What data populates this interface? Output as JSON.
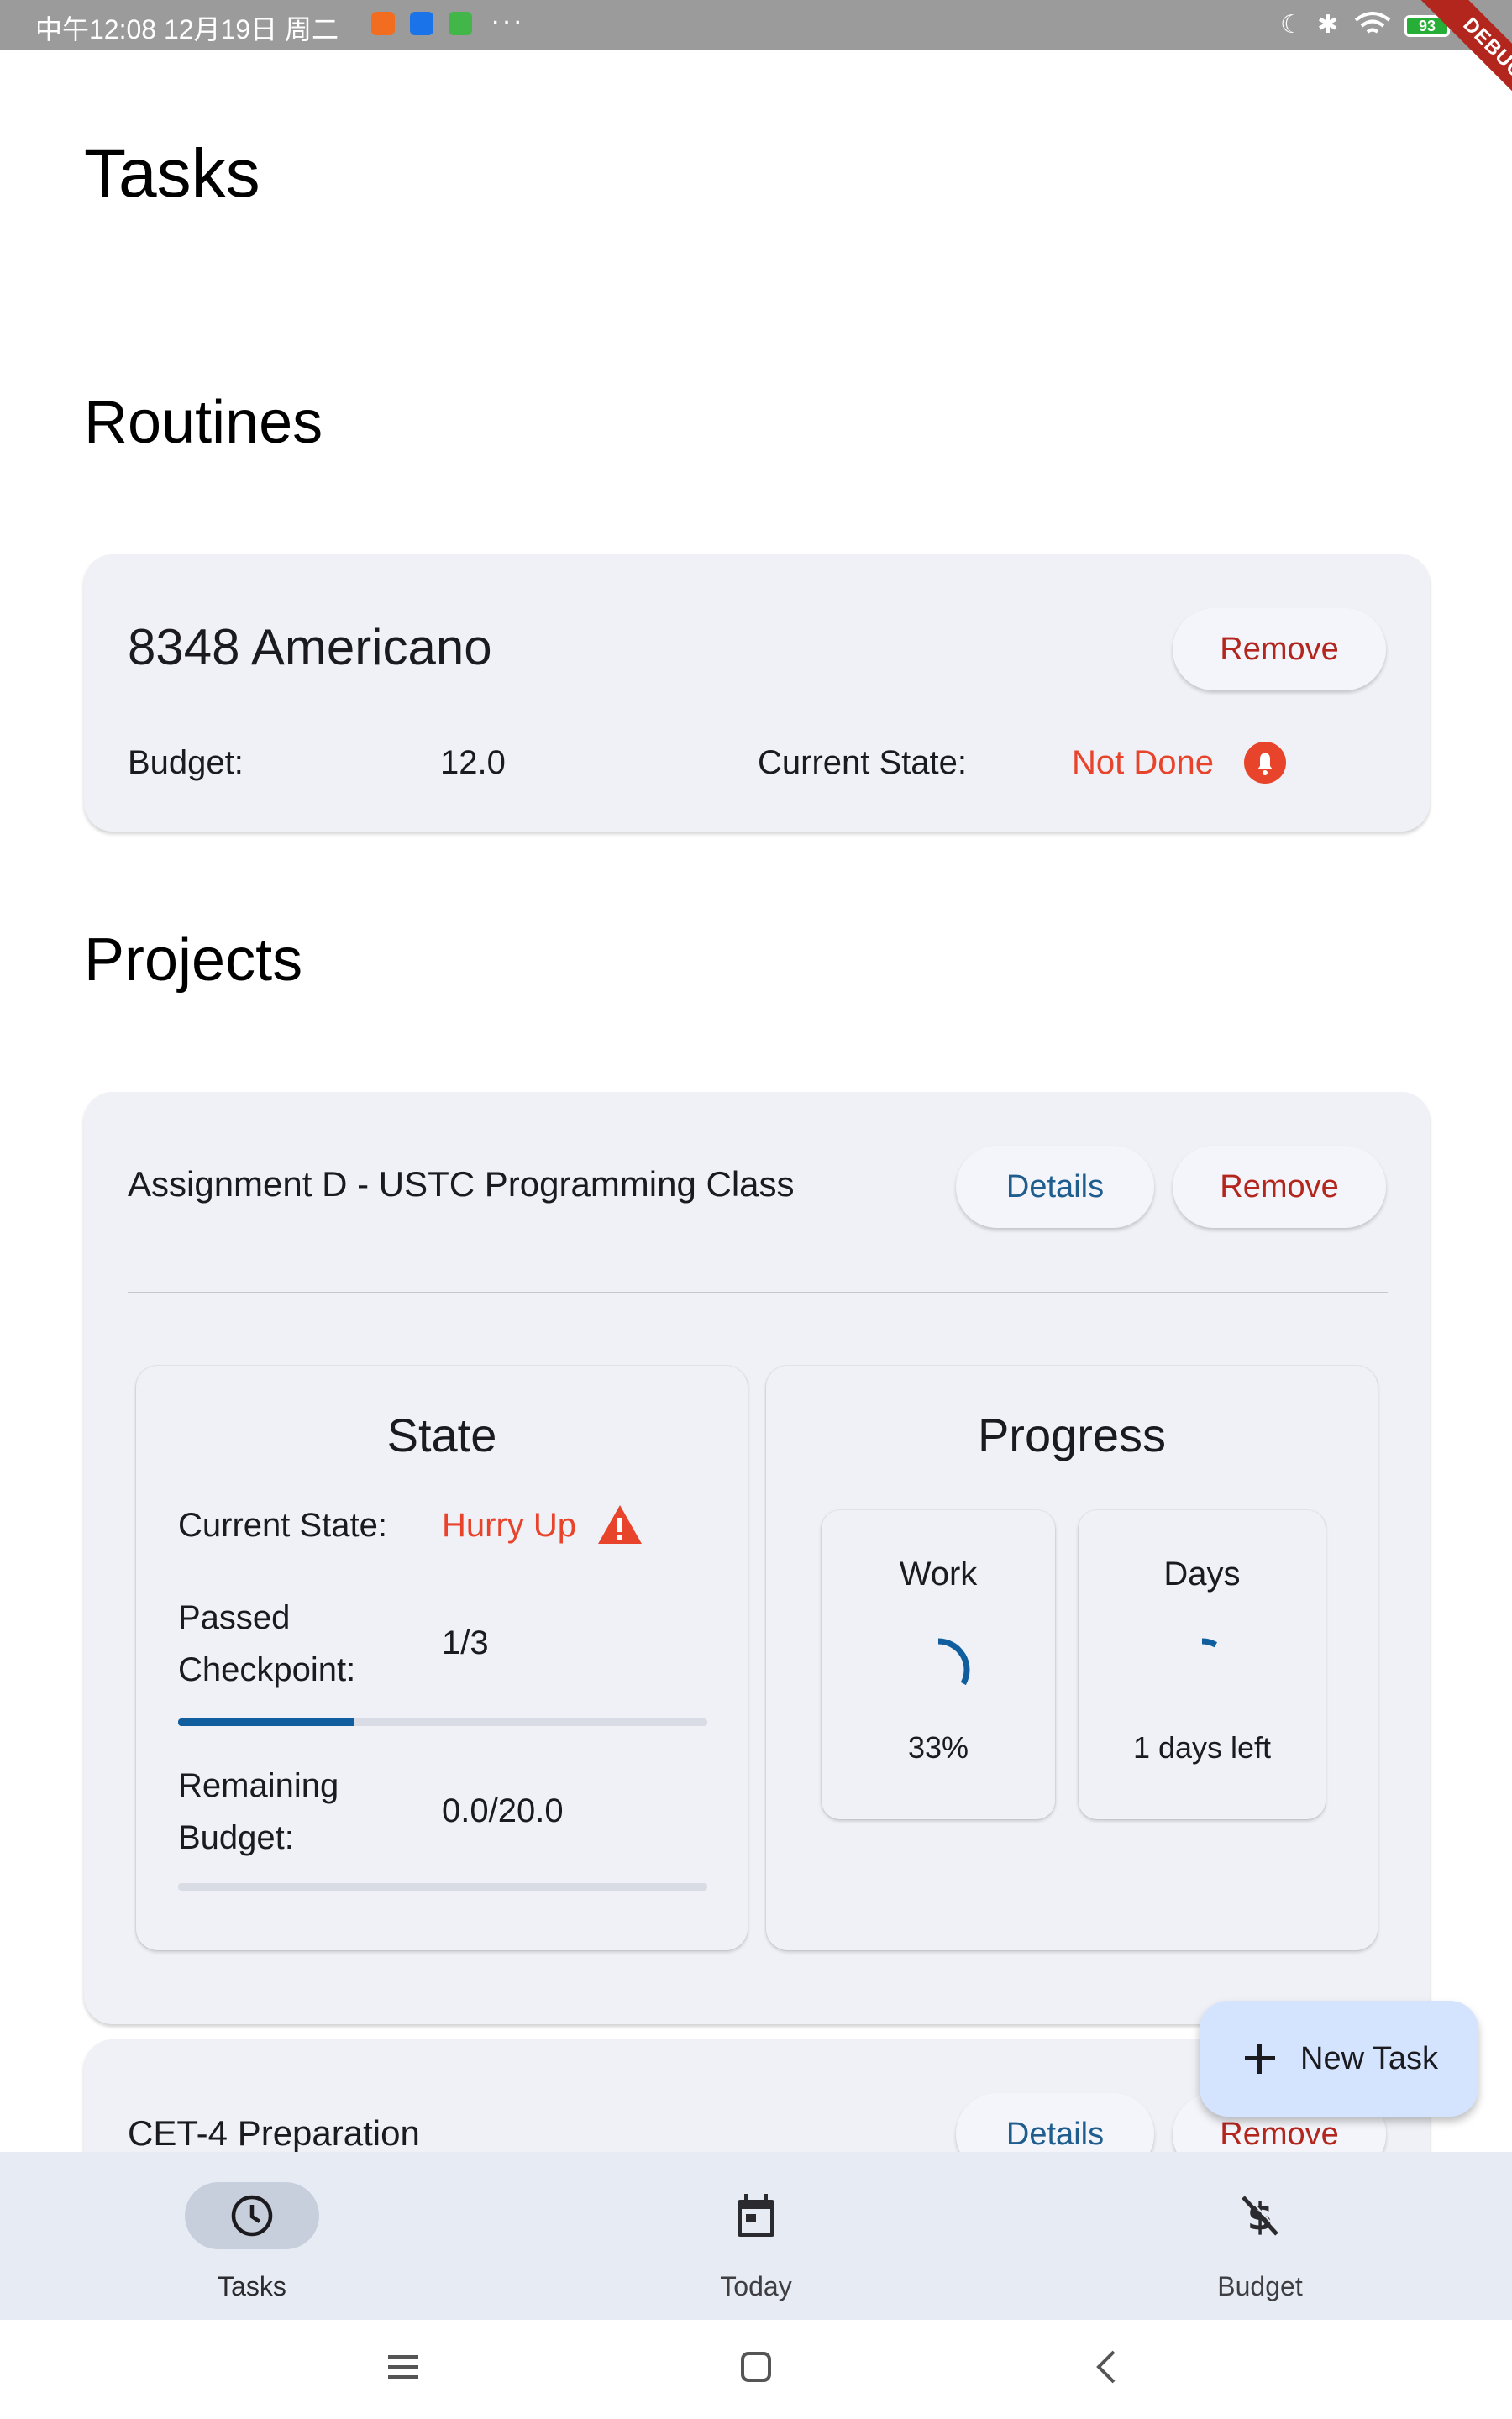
{
  "status_bar": {
    "time": "中午12:08 12月19日 周二",
    "battery": "93",
    "debug_banner": "DEBUG"
  },
  "page_title": "Tasks",
  "routines": {
    "heading": "Routines",
    "item": {
      "name": "8348 Americano",
      "remove_label": "Remove",
      "budget_label": "Budget:",
      "budget_value": "12.0",
      "state_label": "Current State:",
      "state_value": "Not Done"
    }
  },
  "projects": {
    "heading": "Projects",
    "items": [
      {
        "name": "Assignment D - USTC Programming Class",
        "details_label": "Details",
        "remove_label": "Remove",
        "state_panel": {
          "title": "State",
          "current_state_label": "Current State:",
          "current_state_value": "Hurry Up",
          "checkpoint_label_1": "Passed",
          "checkpoint_label_2": "Checkpoint:",
          "checkpoint_value": "1/3",
          "checkpoint_progress": 0.333,
          "budget_label_1": "Remaining",
          "budget_label_2": "Budget:",
          "budget_value": "0.0/20.0",
          "budget_progress": 0.0
        },
        "progress_panel": {
          "title": "Progress",
          "work_title": "Work",
          "work_value": "33%",
          "work_fraction": 0.33,
          "days_title": "Days",
          "days_value": "1 days left",
          "days_fraction": 0.08
        }
      },
      {
        "name": "CET-4 Preparation",
        "details_label": "Details",
        "remove_label": "Remove"
      }
    ]
  },
  "fab": {
    "label": "New Task"
  },
  "bottom_nav": {
    "items": [
      {
        "label": "Tasks",
        "icon": "clock-icon",
        "selected": true
      },
      {
        "label": "Today",
        "icon": "calendar-icon",
        "selected": false
      },
      {
        "label": "Budget",
        "icon": "money-off-icon",
        "selected": false
      }
    ]
  },
  "colors": {
    "accent_red": "#e8432b",
    "button_red": "#b3261e",
    "button_blue": "#1f5d8e",
    "progress_blue": "#115e9e",
    "card_bg": "#eff1f6",
    "fab_bg": "#d4e4ff"
  }
}
